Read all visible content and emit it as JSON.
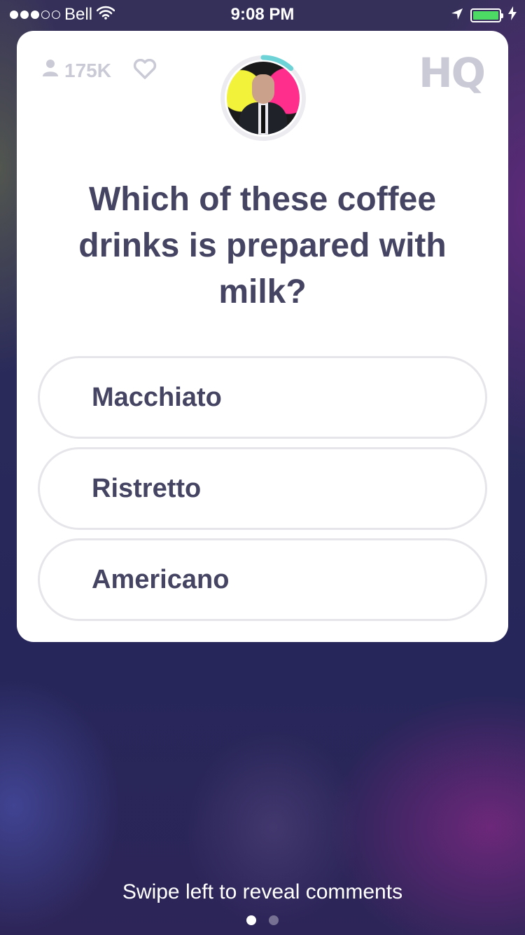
{
  "status_bar": {
    "carrier": "Bell",
    "time": "9:08 PM",
    "signal_filled": 3,
    "signal_total": 5,
    "battery_level": 1.0,
    "battery_color": "#4cd964"
  },
  "card": {
    "viewer_count": "175K",
    "logo": "HQ",
    "timer_color": "#6dd3d6",
    "timer_remaining_fraction": 0.12,
    "question": "Which of these coffee drinks is prepared with milk?",
    "options": [
      "Macchiato",
      "Ristretto",
      "Americano"
    ]
  },
  "footer": {
    "hint": "Swipe left to reveal comments",
    "page_index": 0,
    "page_count": 2
  },
  "icons": [
    "wifi-icon",
    "location-arrow-icon",
    "battery-icon",
    "charging-icon",
    "person-icon",
    "heart-icon"
  ]
}
